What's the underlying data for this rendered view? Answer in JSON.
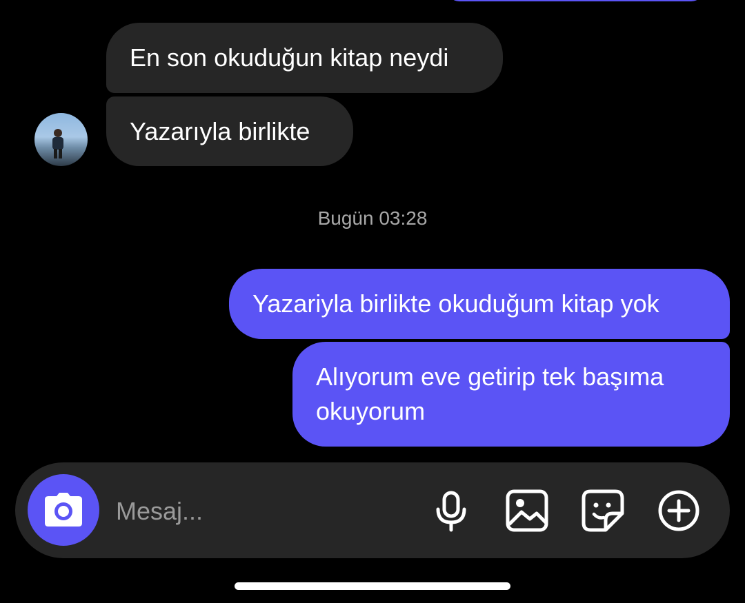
{
  "conversation": {
    "incoming": [
      {
        "text": "En son okuduğun kitap neydi"
      },
      {
        "text": "Yazarıyla birlikte"
      }
    ],
    "timestamp": "Bugün 03:28",
    "outgoing": [
      {
        "text": "Yazariyla birlikte okuduğum kitap yok"
      },
      {
        "text": "Alıyorum eve getirip tek başıma okuyorum"
      }
    ]
  },
  "composer": {
    "placeholder": "Mesaj...",
    "value": "",
    "icons": [
      "camera-icon",
      "microphone-icon",
      "gallery-icon",
      "sticker-icon",
      "plus-icon"
    ]
  },
  "colors": {
    "background": "#000000",
    "incoming_bubble": "#262626",
    "outgoing_bubble": "#5b54f5",
    "accent": "#5b54f5",
    "timestamp_text": "#a8a8a8"
  }
}
